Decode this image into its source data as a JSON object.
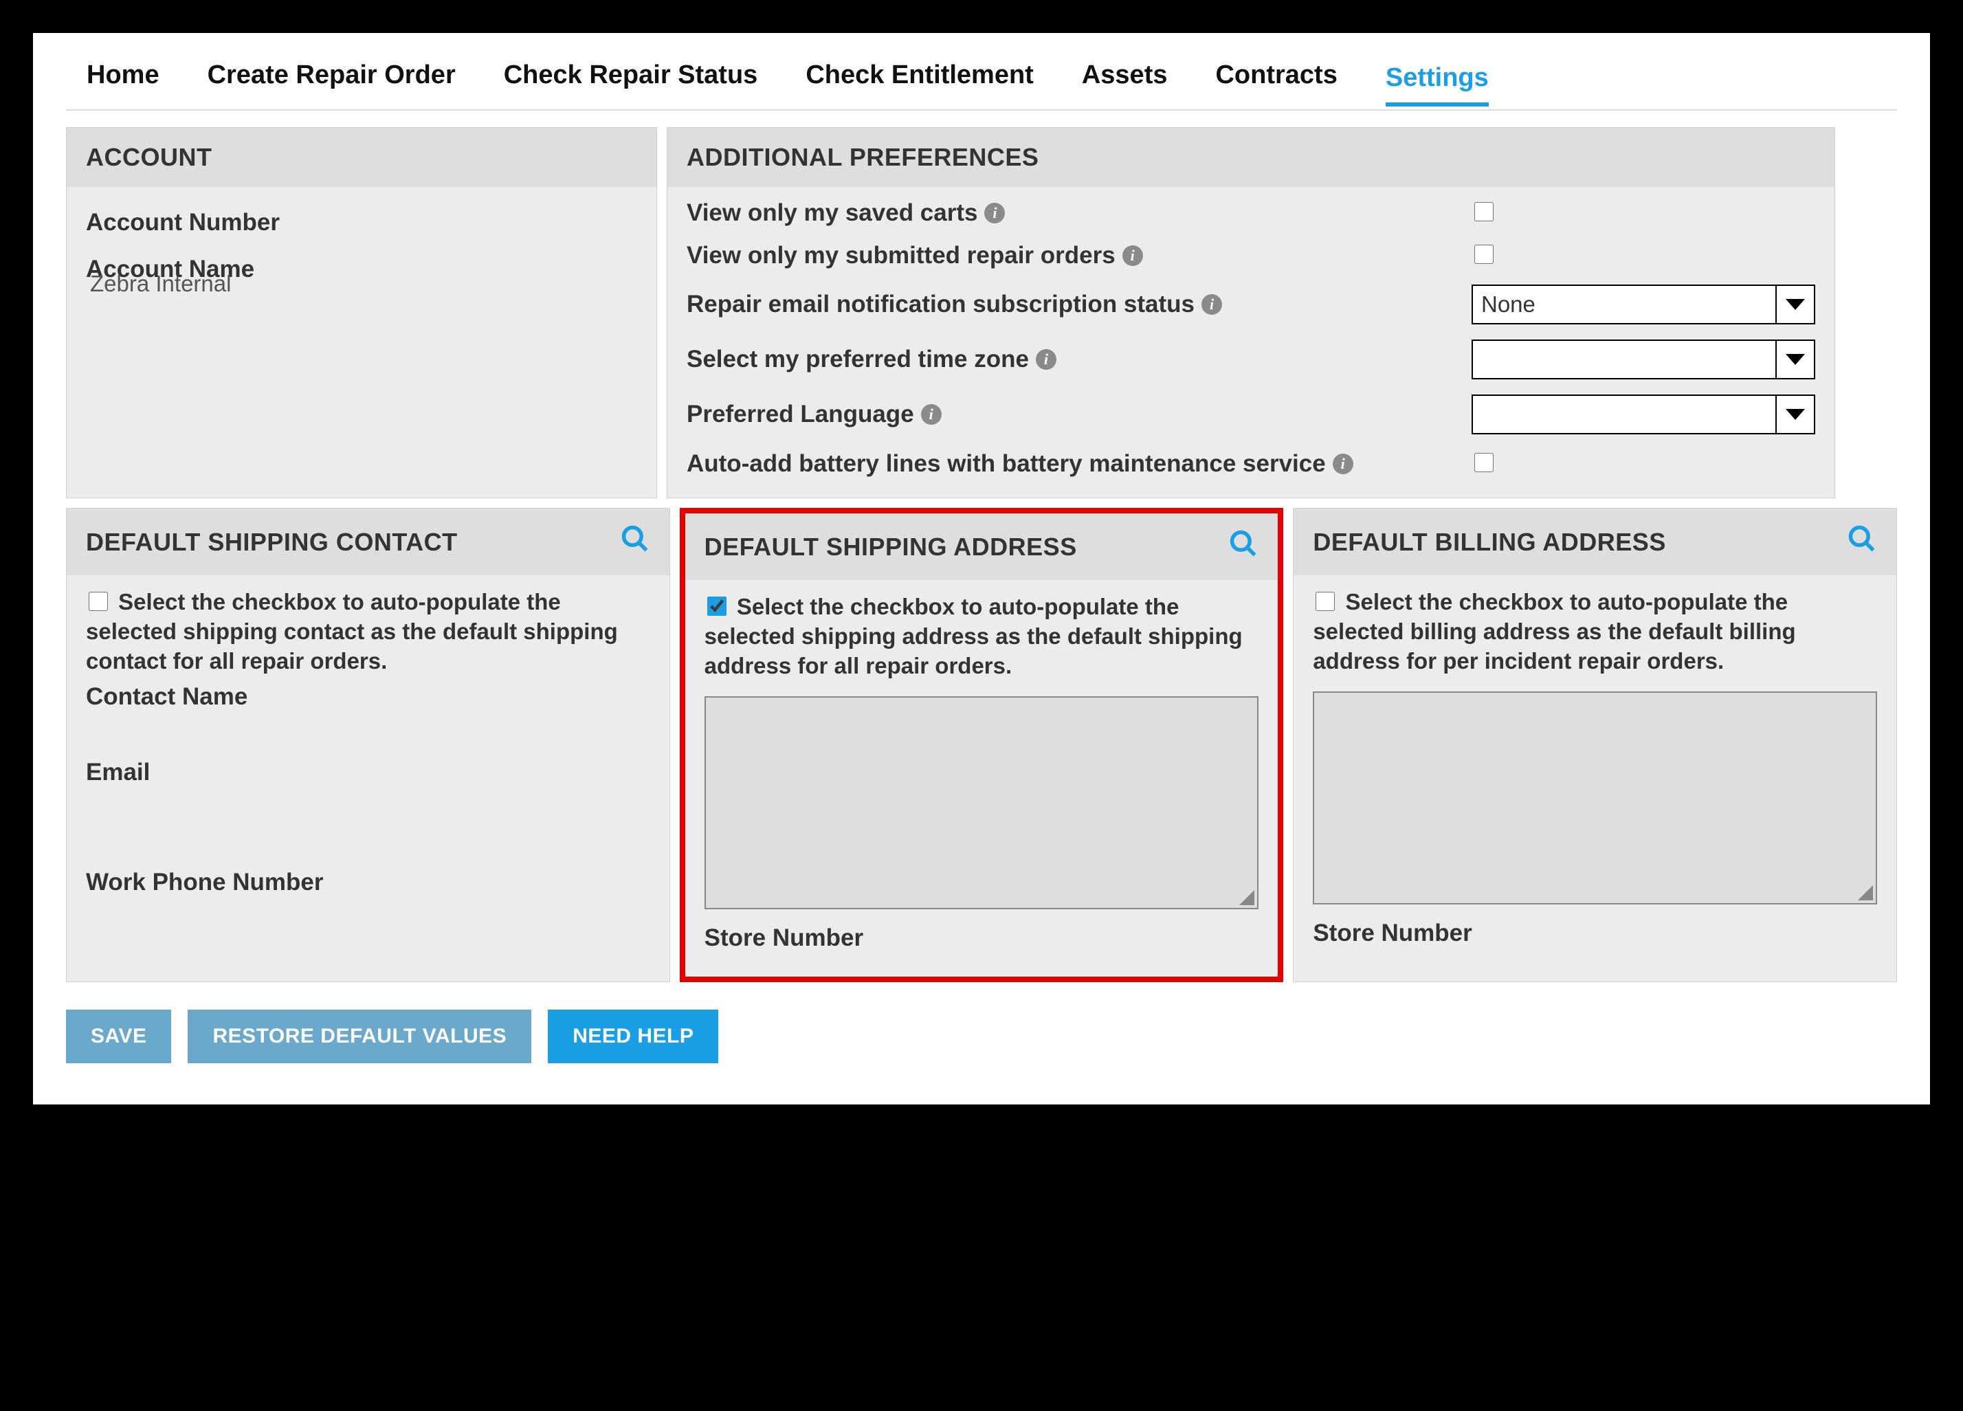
{
  "nav": {
    "items": [
      "Home",
      "Create Repair Order",
      "Check Repair Status",
      "Check Entitlement",
      "Assets",
      "Contracts",
      "Settings"
    ],
    "active_index": 6
  },
  "account": {
    "heading": "ACCOUNT",
    "number_label": "Account Number",
    "number_value": "",
    "name_label": "Account Name",
    "name_value": "Zebra Internal"
  },
  "prefs": {
    "heading": "ADDITIONAL PREFERENCES",
    "view_carts_label": "View only my saved carts",
    "view_carts_checked": false,
    "view_orders_label": "View only my submitted repair orders",
    "view_orders_checked": false,
    "email_sub_label": "Repair email notification subscription status",
    "email_sub_value": "None",
    "timezone_label": "Select my preferred time zone",
    "timezone_value": "",
    "language_label": "Preferred Language",
    "language_value": "",
    "auto_battery_label": "Auto-add battery lines with battery maintenance service",
    "auto_battery_checked": false
  },
  "contact_panel": {
    "heading": "DEFAULT SHIPPING CONTACT",
    "auto_text": "Select the checkbox to auto-populate the selected shipping contact as the default shipping contact for all repair orders.",
    "auto_checked": false,
    "contact_name_label": "Contact Name",
    "email_label": "Email",
    "work_phone_label": "Work Phone Number"
  },
  "ship_panel": {
    "heading": "DEFAULT SHIPPING ADDRESS",
    "auto_text": "Select the checkbox to auto-populate the selected shipping address as the default shipping address for all repair orders.",
    "auto_checked": true,
    "store_label": "Store Number"
  },
  "bill_panel": {
    "heading": "DEFAULT BILLING ADDRESS",
    "auto_text": "Select the checkbox to auto-populate the selected billing address as the default billing address for per incident repair orders.",
    "auto_checked": false,
    "store_label": "Store Number"
  },
  "buttons": {
    "save": "SAVE",
    "restore": "RESTORE DEFAULT VALUES",
    "help": "NEED HELP"
  }
}
